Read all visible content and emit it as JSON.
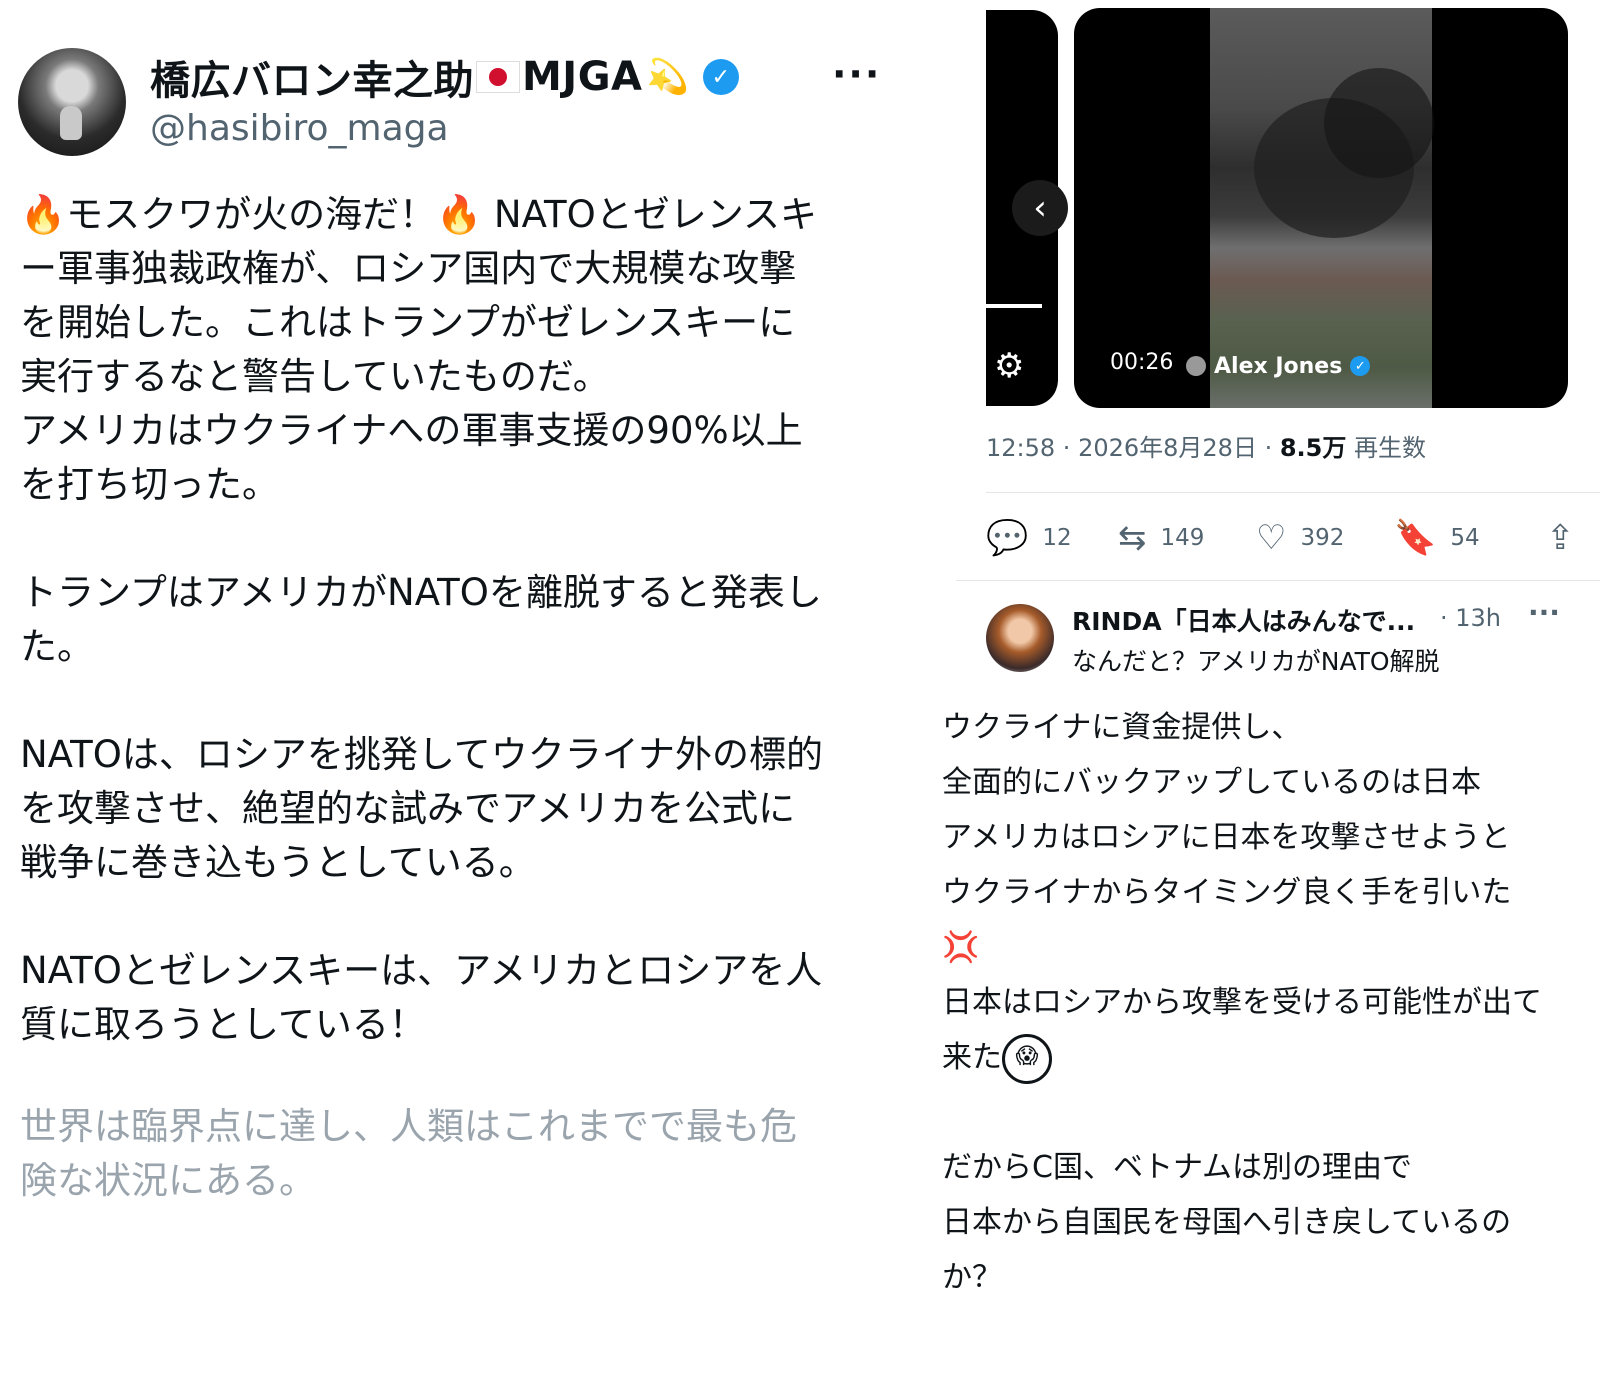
{
  "tweet": {
    "display_name": "橋広バロン幸之助",
    "display_name_suffix": "MJGA",
    "handle": "@hasibiro_maga",
    "lines": [
      "モスクワが火の海だ！",
      "NATOとゼレンスキ",
      "ー軍事独裁政権が、ロシア国内で大規模な攻撃",
      "を開始した。これはトランプがゼレンスキーに",
      "実行するなと警告していたものだ。",
      "アメリカはウクライナへの軍事支援の90%以上",
      "を打ち切った。",
      "",
      "トランプはアメリカがNATOを離脱すると発表し",
      "た。",
      "",
      "NATOは、ロシアを挑発してウクライナ外の標的",
      "を攻撃させ、絶望的な試みでアメリカを公式に",
      "戦争に巻き込もうとしている。",
      "",
      "NATOとゼレンスキーは、アメリカとロシアを人",
      "質に取ろうとしている！"
    ],
    "faded_lines": [
      "世界は臨界点に達し、人類はこれまでで最も危",
      "険な状況にある。"
    ],
    "icons": {
      "fire": "fire-emoji",
      "flag": "japan-flag-emoji",
      "sparkle": "dizzy-emoji",
      "verified": "verified-badge"
    }
  },
  "video": {
    "time": "00:26",
    "author": "Alex Jones"
  },
  "post_meta": {
    "time": "12:58",
    "date": "2026年8月28日",
    "views": "8.5万",
    "views_label": "再生数"
  },
  "actions": {
    "replies": "12",
    "retweets": "149",
    "likes": "392",
    "bookmarks": "54"
  },
  "reply": {
    "name": "RINDA「日本人はみんなで...",
    "time": "· 13h",
    "text": "なんだと？アメリカがNATO解脱"
  },
  "comment": {
    "lines": [
      "ウクライナに資金提供し、",
      "全面的にバックアップしているのは日本",
      "アメリカはロシアに日本を攻撃させようと",
      "ウクライナからタイミング良く手を引いた"
    ],
    "line5": "日本はロシアから攻撃を受ける可能性が出て",
    "line6": "来た",
    "line7": "だからC国、ベトナムは別の理由で",
    "line8": "日本から自国民を母国へ引き戻しているの",
    "line9": "か？"
  },
  "colors": {
    "accent": "#1d9bf0",
    "muted": "#536471",
    "text": "#0f1419"
  }
}
